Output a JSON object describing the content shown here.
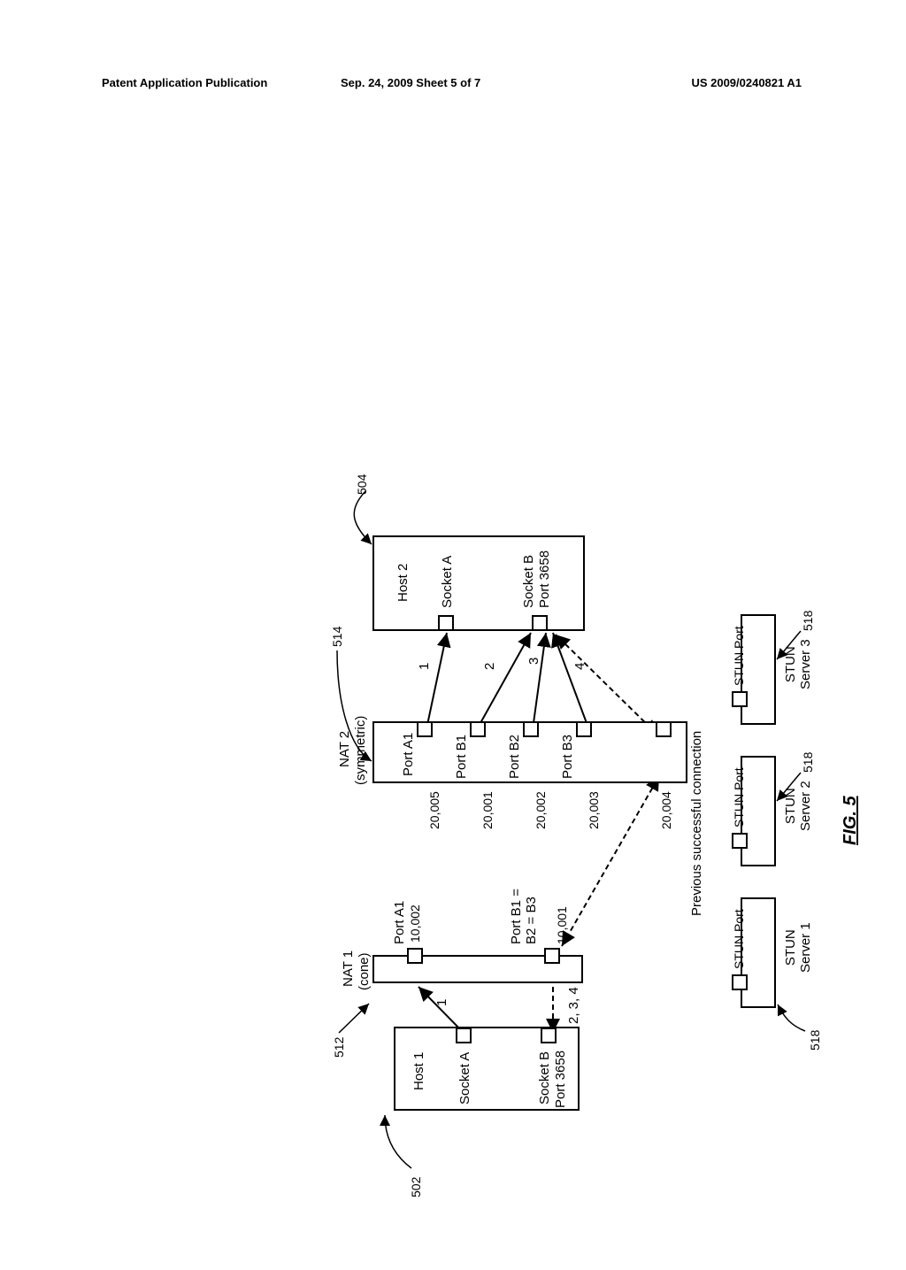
{
  "header": {
    "left": "Patent Application Publication",
    "center": "Sep. 24, 2009  Sheet 5 of 7",
    "right": "US 2009/0240821 A1"
  },
  "fig": {
    "label": "FIG. 5",
    "host1": {
      "title": "Host 1",
      "ref": "502",
      "socketA": "Socket A",
      "socketB_line1": "Socket B",
      "socketB_line2": "Port 3658"
    },
    "nat1": {
      "title1": "NAT 1",
      "title2": "(cone)",
      "ref": "512",
      "portA1": "Port A1",
      "portA1_num": "10,002",
      "portB": "Port B1 =\nB2 = B3",
      "portB_num": "10,001",
      "arrow1": "1",
      "arrow234": "2, 3, 4"
    },
    "prevConn": "Previous successful connection",
    "nat2": {
      "title1": "NAT 2",
      "title2": "(symmetric)",
      "ref": "514",
      "portA1": "Port A1",
      "portA1_num": "20,005",
      "portB1": "Port B1",
      "portB1_num": "20,001",
      "portB2": "Port B2",
      "portB2_num": "20,002",
      "portB3": "Port B3",
      "portB3_num": "20,003",
      "pred": "20,004",
      "a1": "1",
      "a2": "2",
      "a3": "3",
      "a4": "4"
    },
    "host2": {
      "title": "Host 2",
      "ref": "504",
      "socketA": "Socket A",
      "socketB_line1": "Socket B",
      "socketB_line2": "Port 3658"
    },
    "stun": {
      "port": "STUN Port",
      "s1": "STUN\nServer 1",
      "s2": "STUN\nServer 2",
      "s3": "STUN\nServer 3",
      "ref": "518"
    }
  }
}
